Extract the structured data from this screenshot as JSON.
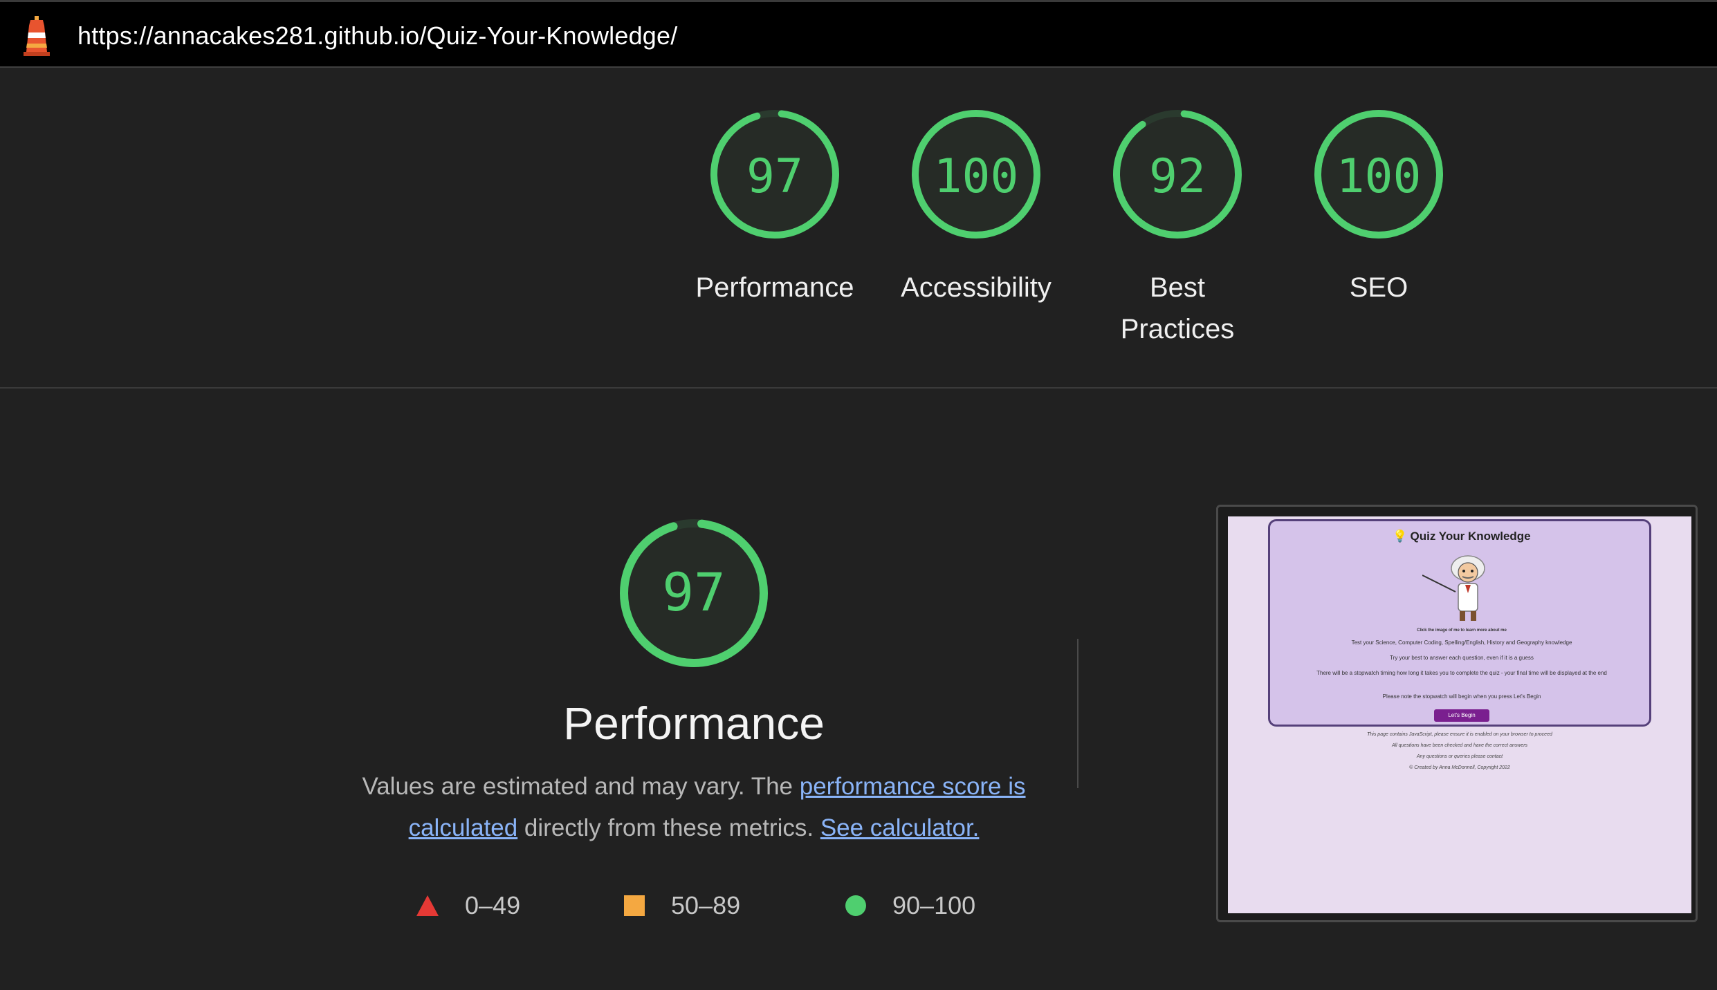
{
  "topbar": {
    "url": "https://annacakes281.github.io/Quiz-Your-Knowledge/",
    "logo_icon": "lighthouse-icon"
  },
  "gauges": [
    {
      "score": "97",
      "label": "Performance",
      "value": 97
    },
    {
      "score": "100",
      "label": "Accessibility",
      "value": 100
    },
    {
      "score": "92",
      "label": "Best Practices",
      "value": 92
    },
    {
      "score": "100",
      "label": "SEO",
      "value": 100
    }
  ],
  "performance": {
    "score": "97",
    "value": 97,
    "title": "Performance",
    "desc_prefix": "Values are estimated and may vary. The ",
    "link_score": "performance score is calculated",
    "desc_middle": " directly from these metrics. ",
    "link_calculator": "See calculator."
  },
  "legend": [
    {
      "icon": "triangle-icon",
      "range": "0–49",
      "color": "#e53935"
    },
    {
      "icon": "square-icon",
      "range": "50–89",
      "color": "#f4a841"
    },
    {
      "icon": "circle-icon",
      "range": "90–100",
      "color": "#4fcf6f"
    }
  ],
  "colors": {
    "pass": "#4fcf6f",
    "background": "#212121",
    "link": "#8ab4f8"
  },
  "thumbnail": {
    "title": "Quiz Your Knowledge",
    "click_text": "Click the image of me to learn more about me",
    "line1": "Test your Science, Computer Coding, Spelling/English, History and Geography knowledge",
    "line2": "Try your best to answer each question, even if it is a guess",
    "line3": "There will be a stopwatch timing how long it takes you to complete the quiz - your final time will be displayed at the end",
    "line4": "Please note the stopwatch will begin when you press Let's Begin",
    "button": "Let's Begin",
    "foot1": "This page contains JavaScript, please ensure it is enabled on your browser to proceed",
    "foot2": "All questions have been checked and have the correct answers",
    "foot3": "Any questions or queries please contact",
    "foot4": "© Created by Anna McDonnell, Copyright 2022"
  }
}
